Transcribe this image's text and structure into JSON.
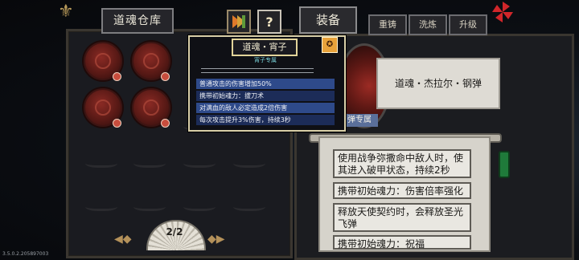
{
  "left_panel": {
    "title": "道魂仓库",
    "pager": "2/2"
  },
  "right_panel": {
    "tabs": {
      "main": "装备",
      "t1": "重铸",
      "t2": "洗炼",
      "t3": "升级"
    },
    "item_name": "道魂・杰拉尔・钢弹",
    "tag": "弹专属",
    "effects": [
      "使用战争弥撒命中敌人时，使其进入破甲状态，持续2秒",
      "携带初始魂力：伤害倍率强化",
      "释放天使契约时，会释放圣光飞弹",
      "携带初始魂力：祝福"
    ]
  },
  "tooltip": {
    "title": "道魂・宵子",
    "subtitle": "宵子专属",
    "lines": [
      "普通攻击的伤害增加50%",
      "携带初始魂力：拔刀术",
      "对满血的敌人必定造成2倍伤害",
      "每次攻击提升3%伤害，持续3秒"
    ]
  },
  "version": "3.5.0.2.205897003"
}
